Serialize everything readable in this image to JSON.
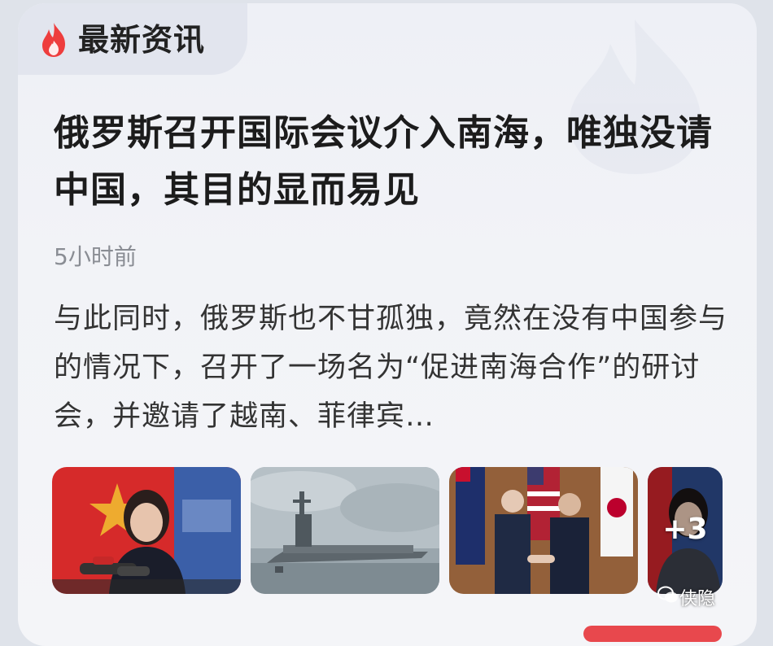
{
  "header": {
    "title": "最新资讯"
  },
  "article": {
    "title": "俄罗斯召开国际会议介入南海，唯独没请中国，其目的显而易见",
    "time_ago": "5小时前",
    "summary": "与此同时，俄罗斯也不甘孤独，竟然在没有中国参与的情况下，召开了一场名为“促进南海合作”的研讨会，并邀请了越南、菲律宾…"
  },
  "images": {
    "more_count": "+3"
  },
  "watermark": {
    "brand": "侠隐"
  },
  "colors": {
    "accent": "#e8484d",
    "card_bg": "#f2f3f7"
  },
  "icons": {
    "header": "flame-icon",
    "watermark": "wechat-icon"
  }
}
